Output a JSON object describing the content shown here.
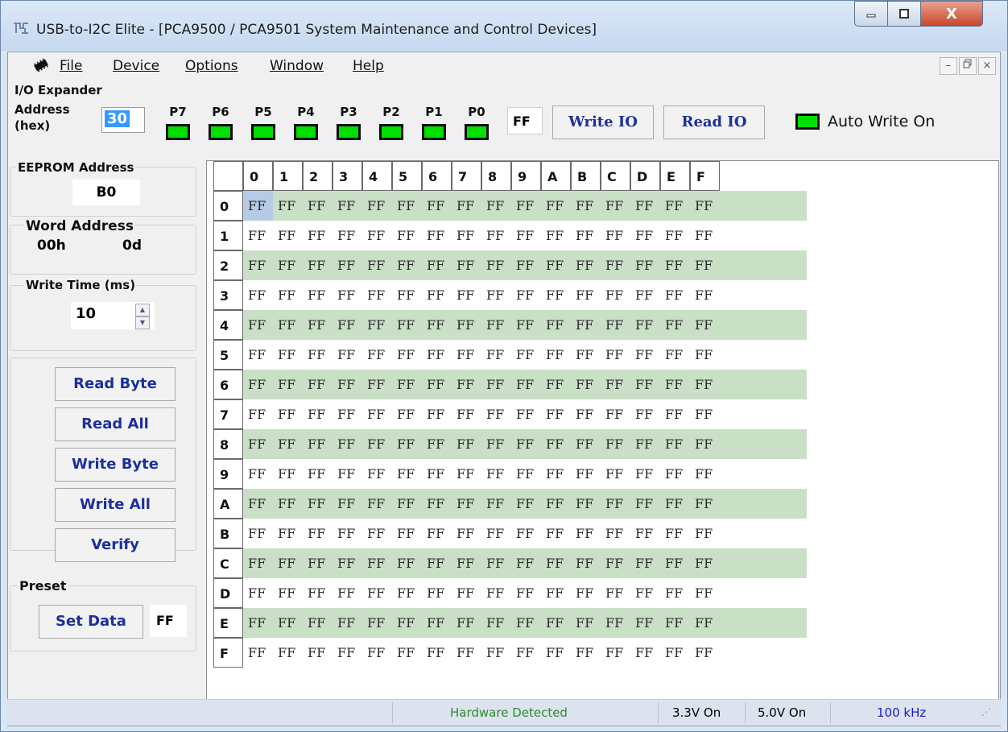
{
  "window": {
    "title": "USB-to-I2C Elite - [PCA9500 / PCA9501 System Maintenance and Control Devices]",
    "close_glyph": "X",
    "min_glyph": "–",
    "max_glyph": "□"
  },
  "menu": {
    "items": [
      "File",
      "Device",
      "Options",
      "Window",
      "Help"
    ],
    "mdi": [
      "–",
      "ᴮ",
      "×"
    ]
  },
  "io_expander": {
    "title": "I/O Expander",
    "address_label_1": "Address",
    "address_label_2": "(hex)",
    "address_value": "30",
    "pins": [
      "P7",
      "P6",
      "P5",
      "P4",
      "P3",
      "P2",
      "P1",
      "P0"
    ],
    "pin_states": [
      1,
      1,
      1,
      1,
      1,
      1,
      1,
      1
    ],
    "value": "FF",
    "write_io": "Write IO",
    "read_io": "Read IO",
    "auto_write": "Auto Write On",
    "led_color": "#00e000"
  },
  "eeprom": {
    "address_title": "EEPROM Address",
    "address_value": "B0",
    "word_title": "Word Address",
    "word_hex": "00h",
    "word_dec": "0d",
    "write_time_title": "Write Time (ms)",
    "write_time_value": "10"
  },
  "actions": {
    "read_byte": "Read Byte",
    "read_all": "Read All",
    "write_byte": "Write Byte",
    "write_all": "Write All",
    "verify": "Verify"
  },
  "preset": {
    "title": "Preset",
    "set_data": "Set Data",
    "value": "FF"
  },
  "grid": {
    "col_headers": [
      "0",
      "1",
      "2",
      "3",
      "4",
      "5",
      "6",
      "7",
      "8",
      "9",
      "A",
      "B",
      "C",
      "D",
      "E",
      "F"
    ],
    "row_headers": [
      "0",
      "1",
      "2",
      "3",
      "4",
      "5",
      "6",
      "7",
      "8",
      "9",
      "A",
      "B",
      "C",
      "D",
      "E",
      "F"
    ],
    "cell_value": "FF",
    "stripe_color": "#c9dfc6",
    "selected_color": "#b6cbe6"
  },
  "status": {
    "hardware": "Hardware Detected",
    "v33": "3.3V On",
    "v50": "5.0V On",
    "speed": "100 kHz",
    "hardware_color": "#2e8b2e",
    "speed_color": "#1a1acc"
  }
}
